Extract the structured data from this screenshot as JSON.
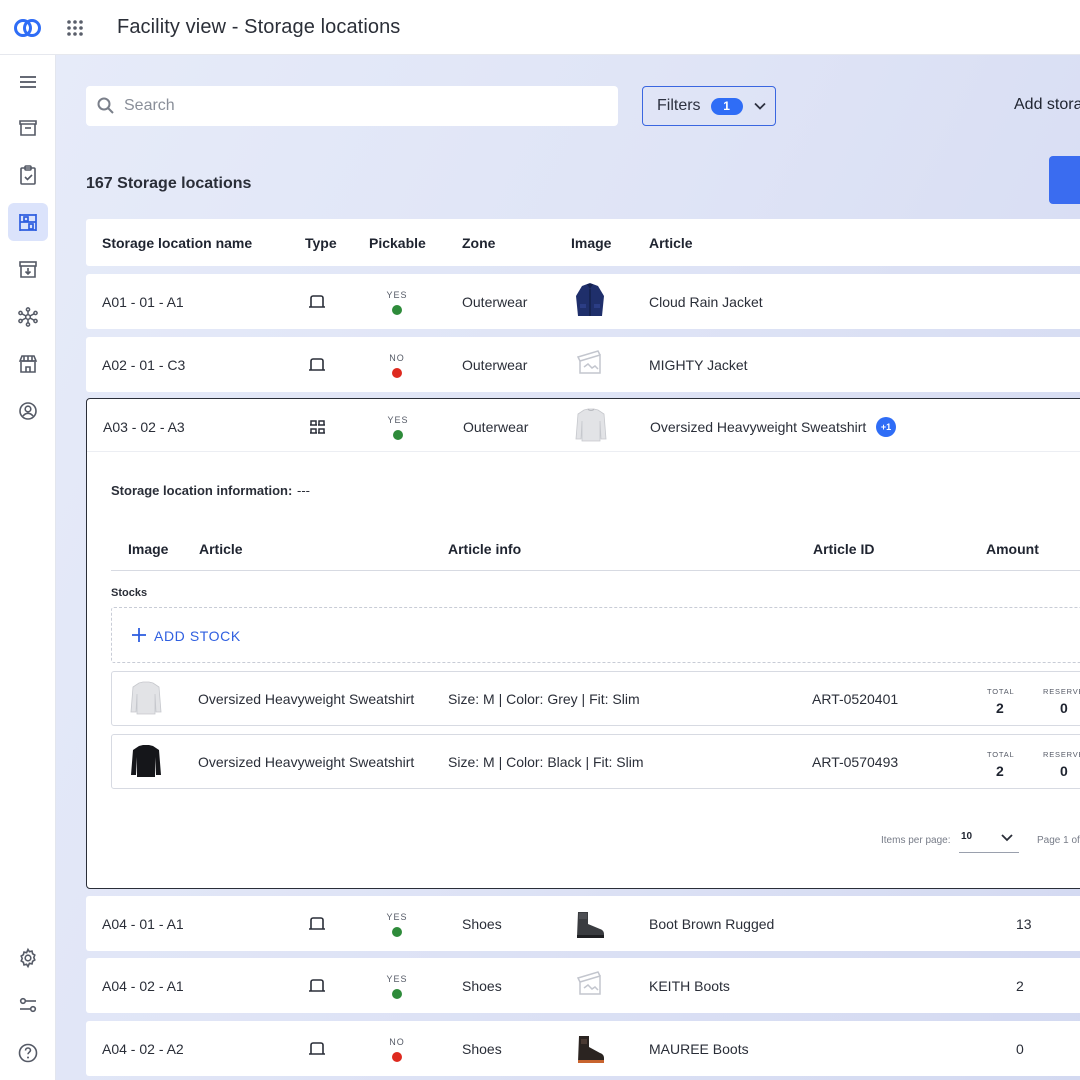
{
  "app": {
    "title": "Facility view - Storage locations"
  },
  "search": {
    "placeholder": "Search"
  },
  "filters": {
    "label": "Filters",
    "count": "1"
  },
  "actions": {
    "add_label": "Add stora"
  },
  "list": {
    "count_label": "167 Storage locations",
    "columns": {
      "name": "Storage location name",
      "type": "Type",
      "pickable": "Pickable",
      "zone": "Zone",
      "image": "Image",
      "article": "Article"
    },
    "rows": [
      {
        "name": "A01 - 01 - A1",
        "pickable": "YES",
        "zone": "Outerwear",
        "article": "Cloud Rain Jacket"
      },
      {
        "name": "A02 - 01 - C3",
        "pickable": "NO",
        "zone": "Outerwear",
        "article": "MIGHTY Jacket"
      },
      {
        "name": "A03 - 02 - A3",
        "pickable": "YES",
        "zone": "Outerwear",
        "article": "Oversized Heavyweight Sweatshirt",
        "extra": "+1"
      },
      {
        "name": "A04 - 01 - A1",
        "pickable": "YES",
        "zone": "Shoes",
        "article": "Boot Brown Rugged",
        "qty": "13"
      },
      {
        "name": "A04 - 02 - A1",
        "pickable": "YES",
        "zone": "Shoes",
        "article": "KEITH Boots",
        "qty": "2"
      },
      {
        "name": "A04 - 02 - A2",
        "pickable": "NO",
        "zone": "Shoes",
        "article": "MAUREE Boots",
        "qty": "0"
      }
    ]
  },
  "details": {
    "info_label": "Storage location information:",
    "info_value": "---",
    "columns": {
      "image": "Image",
      "article": "Article",
      "article_info": "Article info",
      "article_id": "Article ID",
      "amount": "Amount"
    },
    "stocks_label": "Stocks",
    "add_stock_label": "ADD STOCK",
    "stocks": [
      {
        "article": "Oversized Heavyweight Sweatshirt",
        "info": "Size: M | Color: Grey | Fit: Slim",
        "id": "ART-0520401",
        "total_label": "TOTAL",
        "total": "2",
        "reserved_label": "RESERVE",
        "reserved": "0"
      },
      {
        "article": "Oversized Heavyweight Sweatshirt",
        "info": "Size: M | Color: Black | Fit: Slim",
        "id": "ART-0570493",
        "total_label": "TOTAL",
        "total": "2",
        "reserved_label": "RESERVE",
        "reserved": "0"
      }
    ],
    "pager": {
      "items_per_page_label": "Items per page:",
      "items_per_page": "10",
      "page_label": "Page 1 of"
    }
  },
  "colors": {
    "accent": "#2f6df6",
    "pickable_yes": "#2e8b3a",
    "pickable_no": "#de2a1f",
    "active_nav_bg": "#dbe3fb"
  },
  "icons": {
    "sidebar": [
      "menu-icon",
      "storage-bin-icon",
      "clipboard-check-icon",
      "shelf-icon",
      "inbox-icon",
      "network-icon",
      "store-icon",
      "account-icon",
      "settings-icon",
      "sliders-icon",
      "help-icon"
    ],
    "types": [
      "bin-type-icon",
      "multi-bin-type-icon"
    ]
  }
}
